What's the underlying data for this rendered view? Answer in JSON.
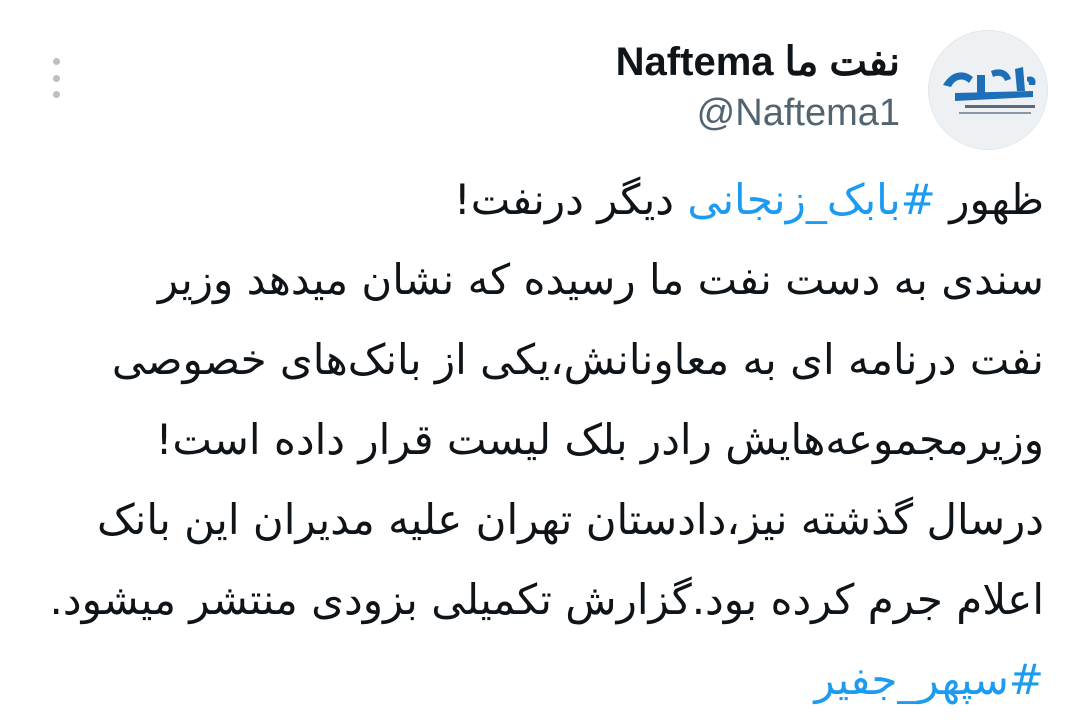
{
  "author": {
    "display_name": "نفت ما Naftema",
    "handle": "@Naftema1",
    "avatar_logo_text": "نفت‌ما"
  },
  "tweet": {
    "line1": {
      "prefix": "ظهور ",
      "hashtag": "#بابک_زنجانی",
      "suffix": " دیگر درنفت!"
    },
    "line2": "سندی به دست نفت ما رسیده که نشان میدهد وزیر",
    "line3": "نفت درنامه ای به معاونانش،یکی از بانک‌های خصوصی",
    "line4": "وزیرمجموعه‌هایش رادر بلک لیست قرار داده است!",
    "line5": "درسال گذشته نیز،دادستان تهران علیه مدیران این بانک",
    "line6": "اعلام جرم کرده بود.گزارش تکمیلی بزودی منتشر میشود.",
    "line7_hashtag": "#سپهر_جفیر"
  },
  "icons": {
    "more": "more-vertical-icon",
    "avatar": "naftema-logo-icon"
  },
  "colors": {
    "text": "#0f1419",
    "secondary": "#536471",
    "link": "#1d9bf0",
    "logo": "#1e6fb8"
  }
}
